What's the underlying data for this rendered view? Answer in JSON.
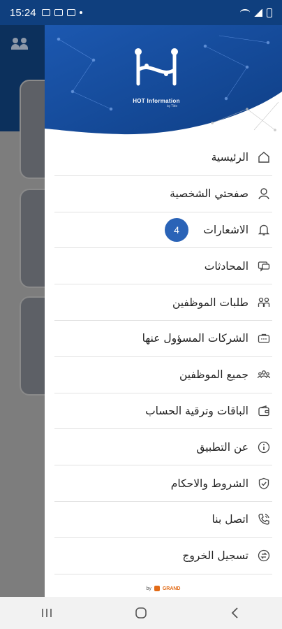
{
  "status_bar": {
    "time": "15:24"
  },
  "drawer": {
    "logo": {
      "title": "HOT Information",
      "subtitle": "by Title"
    },
    "menu": [
      {
        "label": "الرئيسية",
        "icon": "home-icon"
      },
      {
        "label": "صفحتي الشخصية",
        "icon": "user-icon"
      },
      {
        "label": "الاشعارات",
        "icon": "bell-icon",
        "badge": "4"
      },
      {
        "label": "المحادثات",
        "icon": "chat-icon"
      },
      {
        "label": "طلبات الموظفين",
        "icon": "people-icon"
      },
      {
        "label": "الشركات المسؤول عنها",
        "icon": "briefcase-icon"
      },
      {
        "label": "جميع الموظفين",
        "icon": "group-icon"
      },
      {
        "label": "الباقات وترقية الحساب",
        "icon": "wallet-icon"
      },
      {
        "label": "عن التطبيق",
        "icon": "info-icon"
      },
      {
        "label": "الشروط والاحكام",
        "icon": "shield-check-icon"
      },
      {
        "label": "اتصل بنا",
        "icon": "phone-icon"
      },
      {
        "label": "تسجيل الخروج",
        "icon": "logout-icon"
      }
    ],
    "footer": {
      "by": "by",
      "brand": "GRAND"
    }
  },
  "colors": {
    "primary": "#1a4f9c",
    "badge": "#2a63b7",
    "overlay": "#7d7d7d"
  }
}
